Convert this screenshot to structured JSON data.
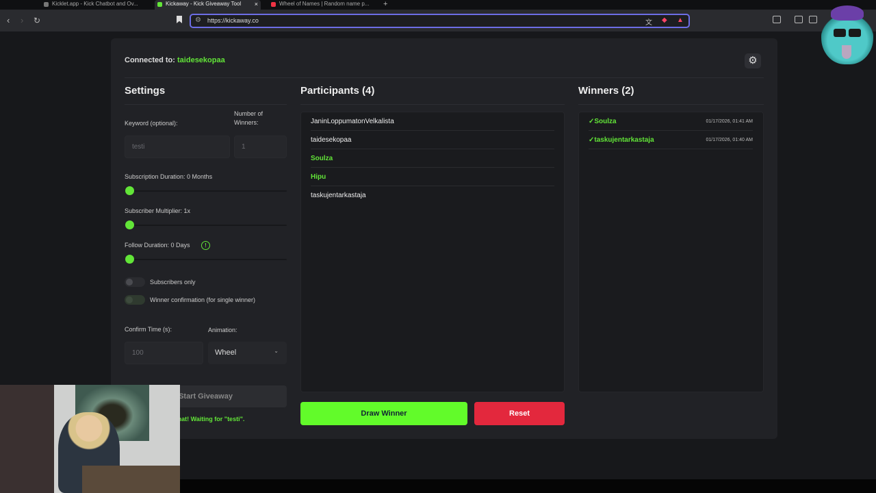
{
  "browser": {
    "tabs": [
      {
        "title": "Kicklet.app - Kick Chatbot and Ov...",
        "active": false
      },
      {
        "title": "Kickaway - Kick Giveaway Tool",
        "active": true
      },
      {
        "title": "Wheel of Names | Random name p...",
        "active": false
      }
    ],
    "url": "https://kickaway.co"
  },
  "header": {
    "connected_label": "Connected to:",
    "channel": "taidesekopaa"
  },
  "settings": {
    "title": "Settings",
    "keyword_label": "Keyword (optional):",
    "keyword_value": "testi",
    "winners_label": "Number of Winners:",
    "winners_value": "1",
    "sub_duration_label": "Subscription Duration: 0 Months",
    "sub_multiplier_label": "Subscriber Multiplier: 1x",
    "follow_duration_label": "Follow Duration: 0 Days",
    "subscribers_only_label": "Subscribers only",
    "winner_confirm_label": "Winner confirmation (for single winner)",
    "confirm_time_label": "Confirm Time (s):",
    "confirm_time_value": "100",
    "animation_label": "Animation:",
    "animation_value": "Wheel",
    "start_button": "Start Giveaway",
    "status_text": "to chat! Waiting for \"testi\"."
  },
  "participants": {
    "title": "Participants (4)",
    "items": [
      {
        "name": "JaninLoppumatonVelkalista",
        "highlight": false
      },
      {
        "name": "taidesekopaa",
        "highlight": false
      },
      {
        "name": "Soulza",
        "highlight": true
      },
      {
        "name": "Hipu",
        "highlight": true
      },
      {
        "name": "taskujentarkastaja",
        "highlight": false
      }
    ]
  },
  "winners": {
    "title": "Winners (2)",
    "items": [
      {
        "name": "✓Soulza",
        "time": "01/17/2026, 01:41 AM"
      },
      {
        "name": "✓taskujentarkastaja",
        "time": "01/17/2026, 01:40 AM"
      }
    ]
  },
  "actions": {
    "draw": "Draw Winner",
    "reset": "Reset"
  },
  "colors": {
    "accent": "#62e538",
    "danger": "#e3283d"
  }
}
